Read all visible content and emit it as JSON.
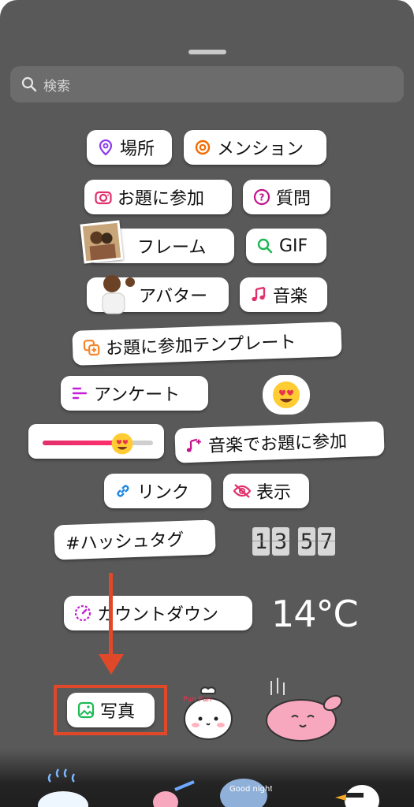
{
  "search": {
    "placeholder": "検索"
  },
  "stickers": {
    "location": "場所",
    "mention": "メンション",
    "add_yours": "お題に参加",
    "questions": "質問",
    "frame": "フレーム",
    "gif": "GIF",
    "avatar": "アバター",
    "music": "音楽",
    "add_yours_template": "お題に参加テンプレート",
    "poll": "アンケート",
    "music_add_yours": "音楽でお題に参加",
    "link": "リンク",
    "reveal": "表示",
    "hashtag": "#ハッシュタグ",
    "clock_digits": [
      "1",
      "3",
      "5",
      "7"
    ],
    "countdown": "カウントダウン",
    "temperature": "14°C",
    "photo": "写真",
    "pun_pun_text": "Pun Pun",
    "good_night_text": "Good night"
  },
  "colors": {
    "sheet_background": "#595959",
    "annotation_accent": "#e0482a",
    "instagram_gradient": [
      "#f58529",
      "#dd2a7b",
      "#8134af"
    ]
  }
}
